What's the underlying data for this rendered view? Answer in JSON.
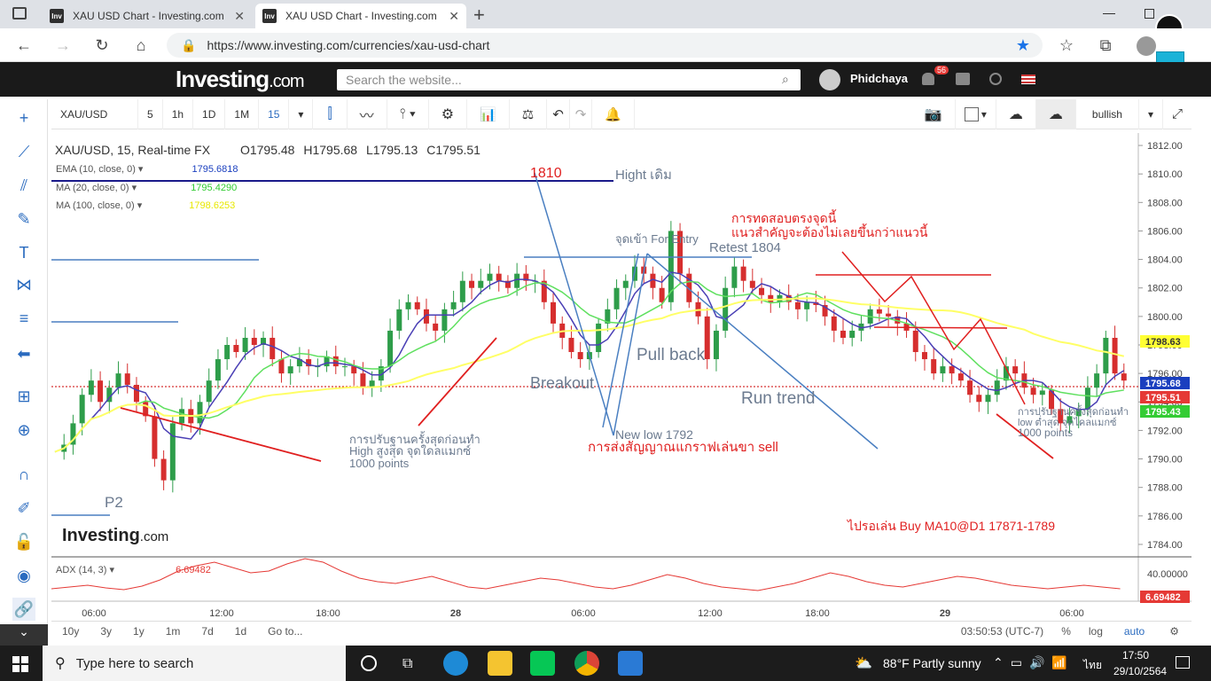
{
  "browser": {
    "tabs": [
      {
        "title": "XAU USD Chart - Investing.com"
      },
      {
        "title": "XAU USD Chart - Investing.com"
      }
    ],
    "url": "https://www.investing.com/currencies/xau-usd-chart"
  },
  "site": {
    "logo": "Investing",
    "logo_suffix": ".com",
    "search_placeholder": "Search the website...",
    "user": "Phidchaya",
    "notif_count": "56"
  },
  "toolbar": {
    "symbol": "XAU/USD",
    "intervals": [
      "5",
      "1h",
      "1D",
      "1M",
      "15"
    ],
    "bullish": "bullish"
  },
  "legend": {
    "title": "XAU/USD, 15, Real-time FX",
    "open": "O1795.48",
    "high": "H1795.68",
    "low": "L1795.13",
    "close": "C1795.51",
    "ema": "EMA (10, close, 0)",
    "ema_val": "1795.6818",
    "ma20": "MA (20, close, 0)",
    "ma20_val": "1795.4290",
    "ma100": "MA (100, close, 0)",
    "ma100_val": "1798.6253",
    "adx": "ADX (14, 3)",
    "adx_val": "6.69482"
  },
  "chart_data": {
    "type": "candlestick",
    "title": "XAU/USD, 15, Real-time FX",
    "ylim": [
      1783.5,
      1812.5
    ],
    "y_ticks": [
      "1812.00",
      "1810.00",
      "1808.00",
      "1806.00",
      "1804.00",
      "1802.00",
      "1800.00",
      "1798.00",
      "1796.00",
      "1794.00",
      "1792.00",
      "1790.00",
      "1788.00",
      "1786.00",
      "1784.00"
    ],
    "x_ticks": [
      "06:00",
      "12:00",
      "18:00",
      "28",
      "06:00",
      "12:00",
      "18:00",
      "29",
      "06:00"
    ],
    "price_labels": [
      {
        "text": "1798.63",
        "color": "#ffff33"
      },
      {
        "text": "1795.68",
        "color": "#1a3fbf"
      },
      {
        "text": "1795.51",
        "color": "#e53935"
      },
      {
        "text": "1795.43",
        "color": "#33cc33"
      }
    ],
    "adx_ticks": [
      "40.00000",
      "6.69482"
    ],
    "annotations": {
      "hight_old": "Hight เดิม",
      "level_1810": "1810",
      "entry": "จุดเข้า For Entry",
      "retest": "Retest 1804",
      "test_note1": "การทดสอบตรงจุดนี้",
      "test_note2": "แนวสำคัญจะต้องไม่เลยขึ้นกว่าแนวนี้",
      "pull_back": "Pull back",
      "breakout": "Breakout",
      "run_trend": "Run trend",
      "new_low": "New low 1792",
      "sell_signal": "การส่งสัญญาณแกราฟเล่นขา sell",
      "adjust1": "การปรับฐานครั้งสุดก่อนทำ",
      "adjust2": "High สูงสุด จุดใดลแมกซ์",
      "adjust3": "1000 points",
      "adjust_r1": "การปรับฐานครั้งสุดก่อนทำ",
      "adjust_r2": "low ต่ำสุด จุดไคลแมกซ์",
      "adjust_r3": "1000 points",
      "p2": "P2",
      "buy_note": "ไปรอเล่น Buy MA10@D1 17871-1789",
      "watermark": "Investing",
      "watermark_suffix": ".com"
    }
  },
  "bottom": {
    "ranges": [
      "10y",
      "3y",
      "1y",
      "1m",
      "7d",
      "1d",
      "Go to..."
    ],
    "time": "03:50:53 (UTC-7)",
    "opts": [
      "%",
      "log",
      "auto"
    ]
  },
  "taskbar": {
    "search": "Type here to search",
    "weather": "88°F  Partly sunny",
    "lang": "ไทย",
    "time": "17:50",
    "date": "29/10/2564"
  }
}
